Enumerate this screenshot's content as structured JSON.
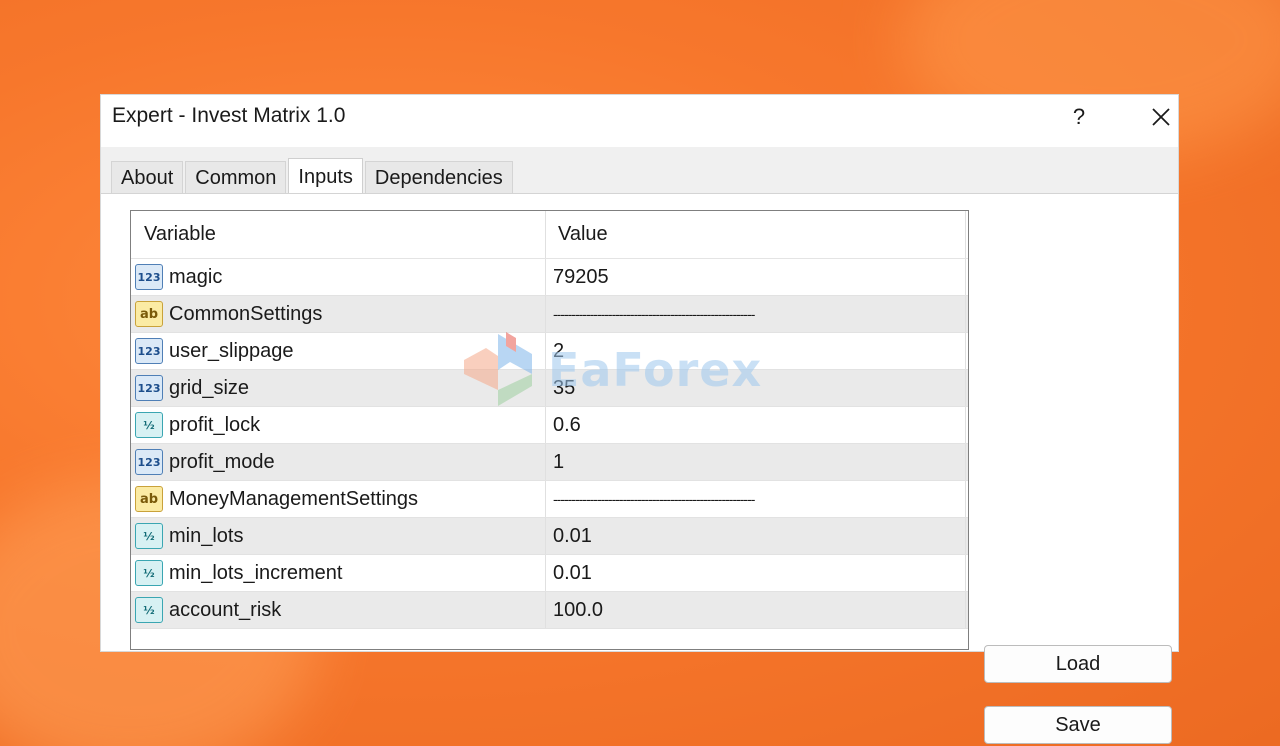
{
  "window": {
    "title": "Expert - Invest Matrix 1.0",
    "help_label": "?"
  },
  "tabs": [
    {
      "label": "About",
      "active": false
    },
    {
      "label": "Common",
      "active": false
    },
    {
      "label": "Inputs",
      "active": true
    },
    {
      "label": "Dependencies",
      "active": false
    }
  ],
  "table": {
    "headers": {
      "variable": "Variable",
      "value": "Value"
    },
    "rows": [
      {
        "name": "magic",
        "value": "79205",
        "type": "int",
        "icon": "integer-type-icon",
        "icon_text": "123"
      },
      {
        "name": "CommonSettings",
        "value": "-------------------------------------------------------",
        "type": "str",
        "icon": "string-type-icon",
        "icon_text": "ab"
      },
      {
        "name": "user_slippage",
        "value": "2",
        "type": "int",
        "icon": "integer-type-icon",
        "icon_text": "123"
      },
      {
        "name": "grid_size",
        "value": "35",
        "type": "int",
        "icon": "integer-type-icon",
        "icon_text": "123"
      },
      {
        "name": "profit_lock",
        "value": "0.6",
        "type": "dbl",
        "icon": "double-type-icon",
        "icon_text": "½"
      },
      {
        "name": "profit_mode",
        "value": "1",
        "type": "int",
        "icon": "integer-type-icon",
        "icon_text": "123"
      },
      {
        "name": "MoneyManagementSettings",
        "value": "-------------------------------------------------------",
        "type": "str",
        "icon": "string-type-icon",
        "icon_text": "ab"
      },
      {
        "name": "min_lots",
        "value": "0.01",
        "type": "dbl",
        "icon": "double-type-icon",
        "icon_text": "½"
      },
      {
        "name": "min_lots_increment",
        "value": "0.01",
        "type": "dbl",
        "icon": "double-type-icon",
        "icon_text": "½"
      },
      {
        "name": "account_risk",
        "value": "100.0",
        "type": "dbl",
        "icon": "double-type-icon",
        "icon_text": "½"
      }
    ]
  },
  "buttons": {
    "load_label": "Load",
    "save_label": "Save"
  },
  "watermark": {
    "text": "EaForex"
  },
  "colors": {
    "background": "#f7772c",
    "dialog": "#f0f0f0",
    "row_alt": "#eaeaea"
  }
}
